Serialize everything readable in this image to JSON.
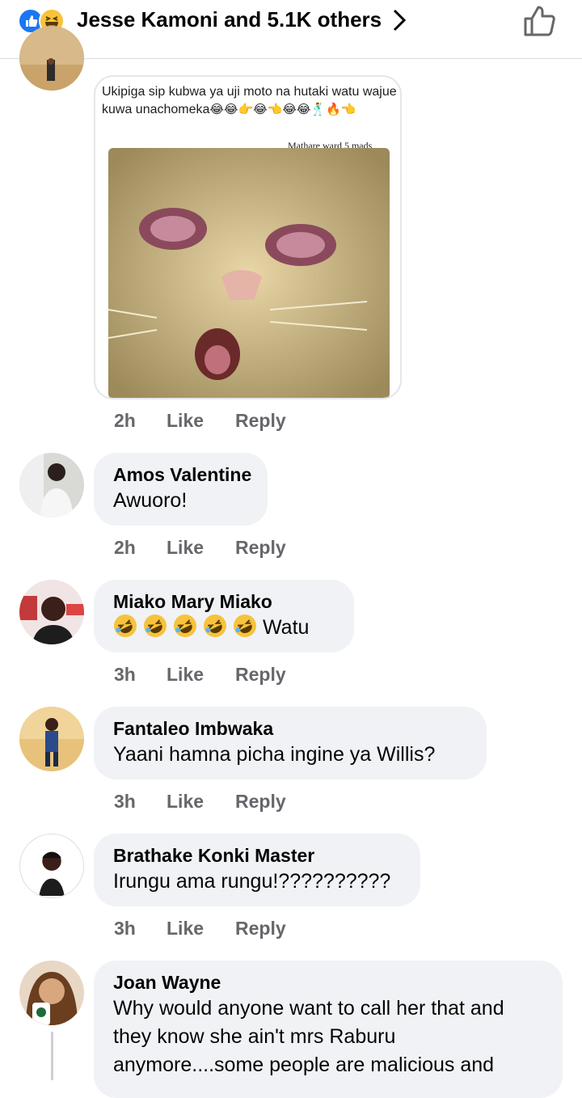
{
  "header": {
    "title": "Jesse Kamoni and 5.1K others",
    "icons": [
      "like-reaction-icon",
      "haha-reaction-icon",
      "chevron-right-icon",
      "thumbs-up-icon"
    ]
  },
  "meme": {
    "caption": "Ukipiga sip kubwa ya uji moto na hutaki watu wajue kuwa unachomeka",
    "caption_emojis": "😂😂👉😂👈😂😂🕺🔥👈",
    "credit": "Mathare ward 5 mads"
  },
  "meme_meta": {
    "time": "2h",
    "like": "Like",
    "reply": "Reply"
  },
  "comments": [
    {
      "name": "Amos Valentine",
      "text": "Awuoro!",
      "time": "2h",
      "like": "Like",
      "reply": "Reply"
    },
    {
      "name": "Miako Mary Miako",
      "text": "Watu",
      "time": "3h",
      "like": "Like",
      "reply": "Reply"
    },
    {
      "name": "Fantaleo Imbwaka",
      "text": "Yaani hamna picha ingine ya Willis?",
      "time": "3h",
      "like": "Like",
      "reply": "Reply"
    },
    {
      "name": "Brathake Konki Master",
      "text": "Irungu ama rungu!??????????",
      "time": "3h",
      "like": "Like",
      "reply": "Reply"
    },
    {
      "name": "Joan Wayne",
      "text_lines": [
        "Why would anyone want to call her that and",
        "they know she ain't mrs Raburu",
        "anymore....some people are malicious and"
      ]
    }
  ],
  "colors": {
    "accent": "#1877f2",
    "bubble": "#f0f2f5",
    "meta": "#65676b"
  }
}
